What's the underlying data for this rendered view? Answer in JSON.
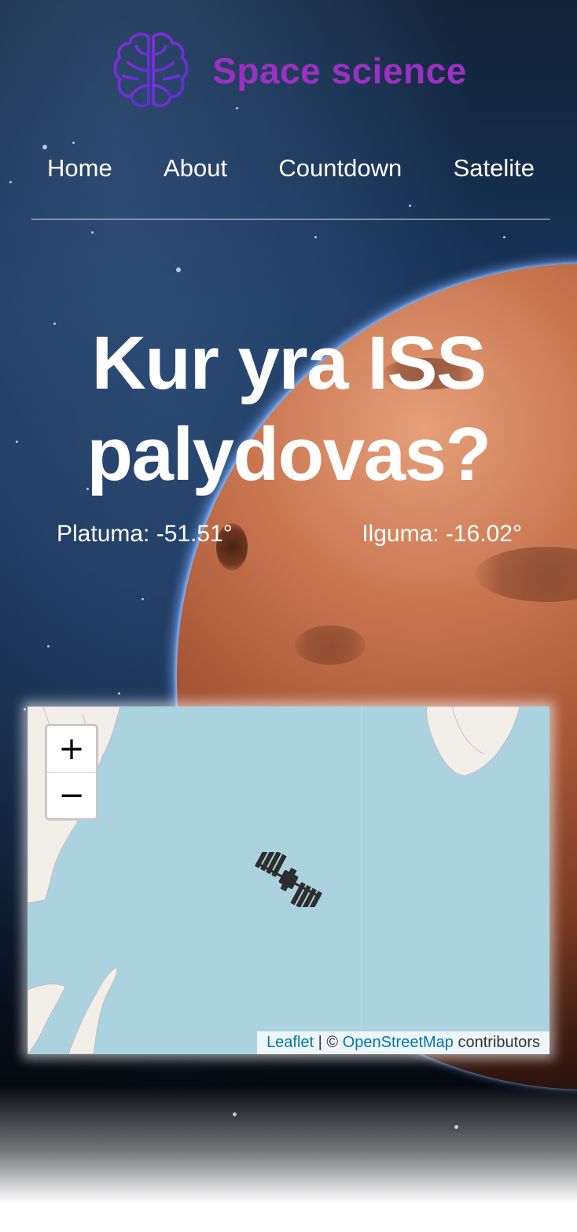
{
  "header": {
    "brand_title": "Space science",
    "logo_icon": "brain-icon",
    "brand_color": "#9a31c2"
  },
  "nav": {
    "items": [
      {
        "label": "Home"
      },
      {
        "label": "About"
      },
      {
        "label": "Countdown"
      },
      {
        "label": "Satelite"
      }
    ]
  },
  "hero": {
    "title": "Kur yra ISS palydovas?",
    "latitude": "Platuma: -51.51°",
    "longitude": "Ilguma: -16.02°"
  },
  "map": {
    "zoom_in_label": "+",
    "zoom_out_label": "−",
    "marker_icon": "iss-satellite-icon",
    "attribution": {
      "leaflet": "Leaflet",
      "separator": " | © ",
      "osm": "OpenStreetMap",
      "contributors": " contributors"
    },
    "water_color": "#aad3df",
    "land_color": "#f2efe9"
  }
}
